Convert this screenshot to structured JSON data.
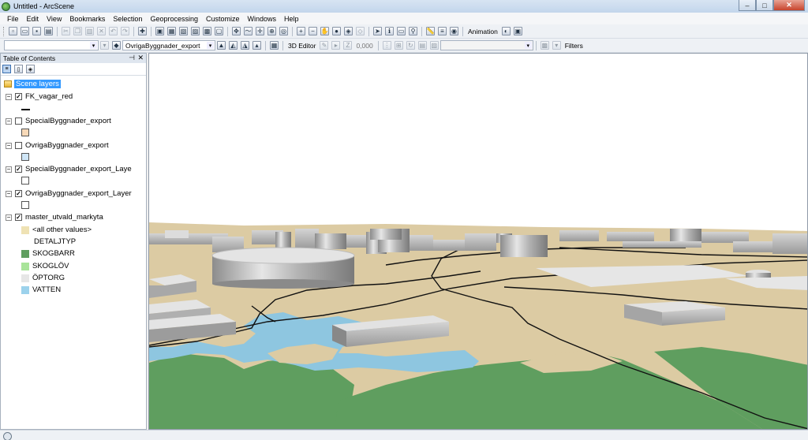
{
  "window": {
    "title": "Untitled - ArcScene",
    "minimize": "–",
    "maximize": "□",
    "close": "✕"
  },
  "menu": [
    "File",
    "Edit",
    "View",
    "Bookmarks",
    "Selection",
    "Geoprocessing",
    "Customize",
    "Windows",
    "Help"
  ],
  "toolbar2": {
    "layer_combo": "OvrigaByggnader_export",
    "editor_label": "3D Editor",
    "z_value": "0,000",
    "filters_label": "Filters",
    "animation_label": "Animation"
  },
  "toc": {
    "header": "Table of Contents",
    "pin": "⊣",
    "close": "✕",
    "scene_layers_label": "Scene layers",
    "layers": [
      {
        "name": "FK_vagar_red",
        "checked": true
      },
      {
        "name": "SpecialByggnader_export",
        "checked": false
      },
      {
        "name": "OvrigaByggnader_export",
        "checked": false
      },
      {
        "name": "SpecialByggnader_export_Laye",
        "checked": true
      },
      {
        "name": "OvrigaByggnader_export_Layer",
        "checked": true
      },
      {
        "name": "master_utvald_markyta",
        "checked": true
      }
    ],
    "legend": {
      "other_values": "<all other values>",
      "heading": "DETALJTYP",
      "classes": [
        {
          "label": "SKOGBARR",
          "color": "#5f9e5f"
        },
        {
          "label": "SKOGLÖV",
          "color": "#a9e49a"
        },
        {
          "label": "ÖPTORG",
          "color": "#e6e6e6"
        },
        {
          "label": "VATTEN",
          "color": "#9cd2ec"
        }
      ]
    },
    "swatches": {
      "special_export": "#f7d9b8",
      "ovriga_export": "#cfe6f7",
      "special_layer": "#ffffff",
      "ovriga_layer": "#ffffff",
      "other_values": "#efe2b4"
    }
  },
  "colors": {
    "ground": "#dccba3",
    "water": "#8ec6e0",
    "forest": "#5f9e5f",
    "sky": "#ffffff",
    "building_top": "#e2e2e2",
    "building_side": "#b8b8b8"
  }
}
